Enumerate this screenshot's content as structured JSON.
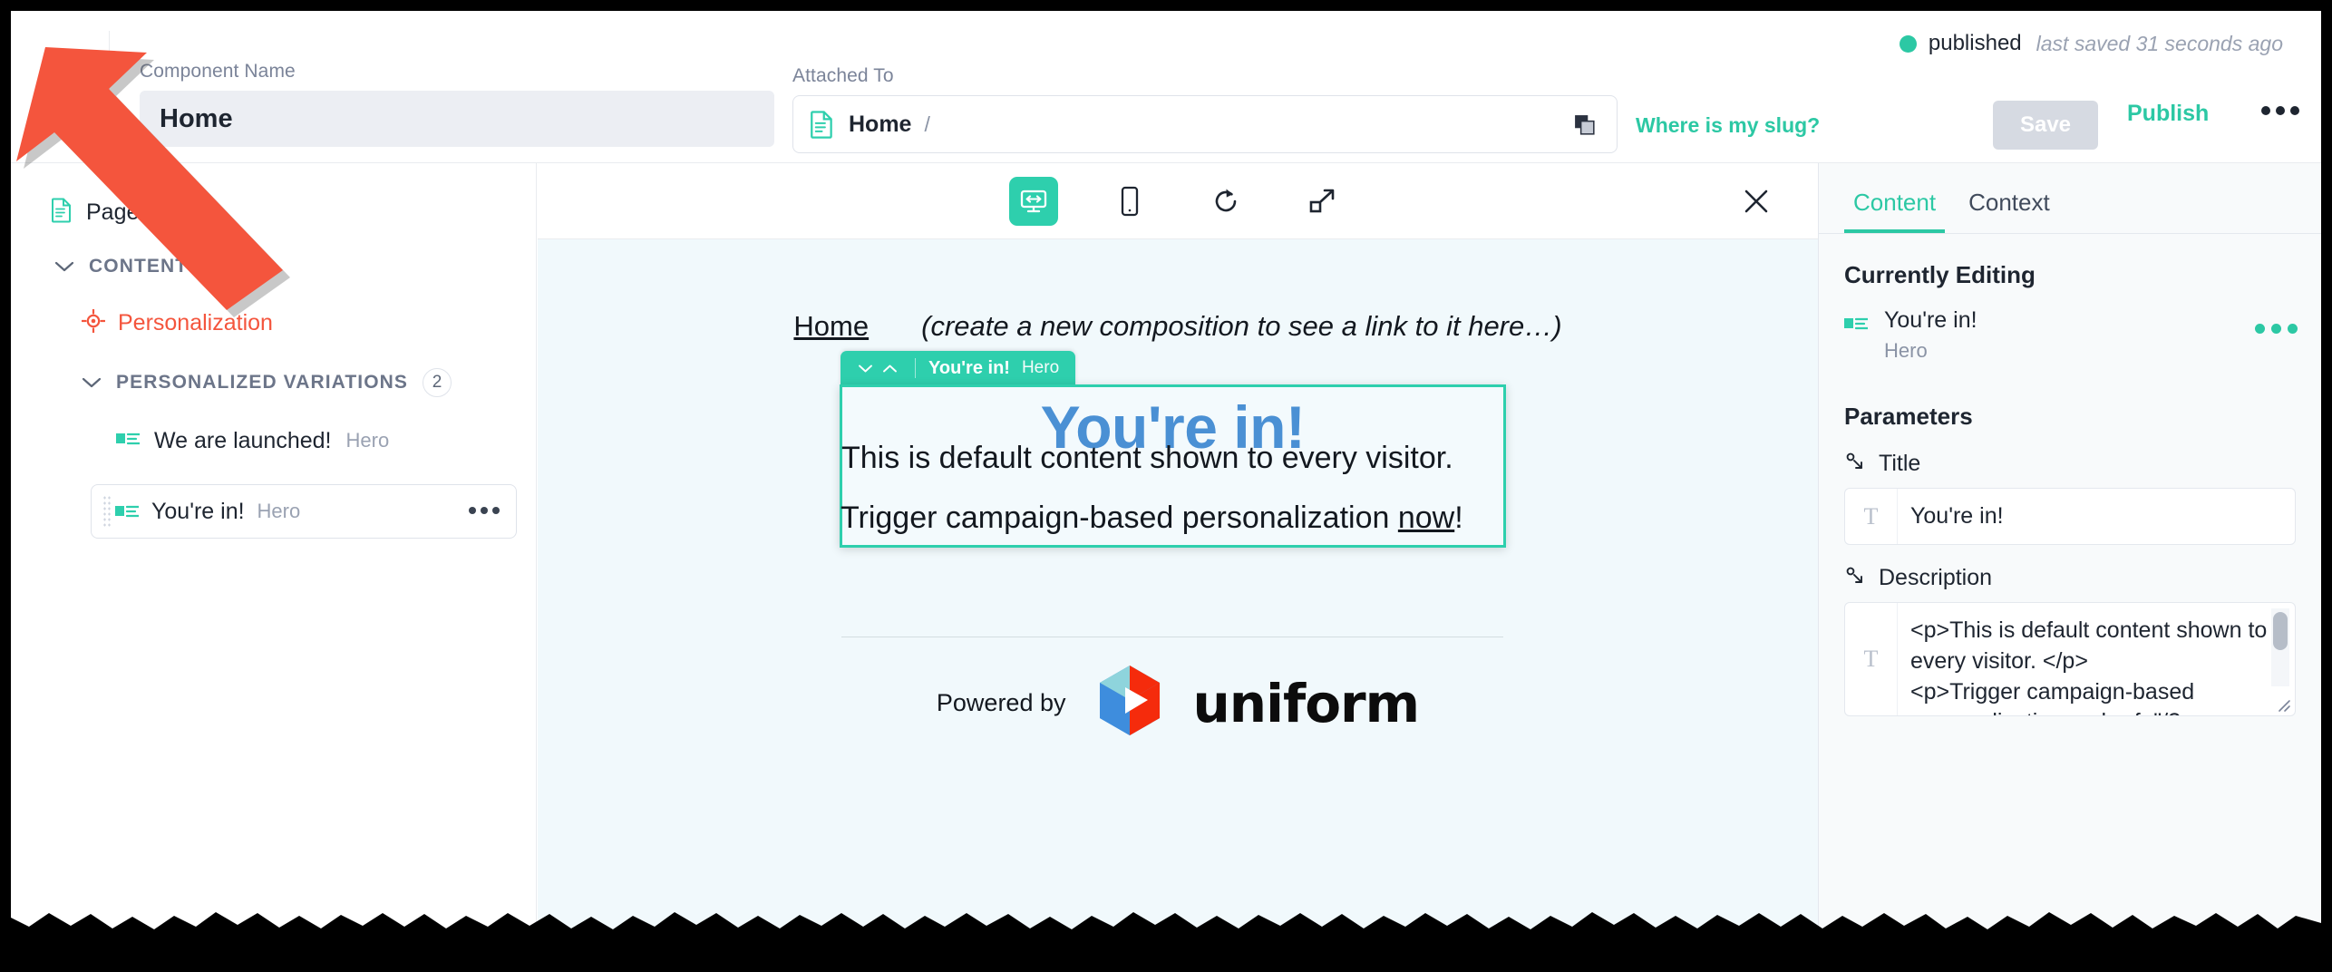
{
  "header": {
    "back_icon": "chevron-left-icon",
    "component_name_label": "Component Name",
    "component_name_value": "Home",
    "component_name_placeholder": "Component Name",
    "attached_to_label": "Attached To",
    "attached_to_value": "Home",
    "attached_to_slug": "/",
    "attached_doc_icon": "document-icon",
    "copy_icon": "copy-icon",
    "where_is_my_slug": "Where is my slug?",
    "status_text": "published",
    "status_color": "#2cc8a4",
    "last_saved": "last saved 31 seconds ago",
    "save_label": "Save",
    "publish_label": "Publish",
    "more_icon": "ellipsis-icon"
  },
  "sidebar": {
    "page_label": "Page",
    "page_icon": "document-icon",
    "content_section": {
      "label": "CONTENT",
      "count": "1",
      "chevron": "chevron-down-icon"
    },
    "personalization": {
      "label": "Personalization",
      "icon": "target-icon",
      "color": "#f4553d"
    },
    "variations_section": {
      "label": "PERSONALIZED VARIATIONS",
      "count": "2",
      "chevron": "chevron-down-icon"
    },
    "variations": [
      {
        "name": "We are launched!",
        "type": "Hero",
        "icon": "component-icon"
      },
      {
        "name": "You're in!",
        "type": "Hero",
        "icon": "component-icon",
        "selected": true,
        "more_icon": "ellipsis-icon"
      }
    ]
  },
  "preview": {
    "toolbar": [
      {
        "name": "desktop-icon",
        "label": "Desktop",
        "active": true
      },
      {
        "name": "mobile-icon",
        "label": "Mobile",
        "active": false
      },
      {
        "name": "refresh-icon",
        "label": "Refresh",
        "active": false
      },
      {
        "name": "expand-icon",
        "label": "Open in new window",
        "active": false
      }
    ],
    "close_icon": "close-icon",
    "nav_home_link": "Home",
    "nav_note": "(create a new composition to see a link to it here…)",
    "hero_tab": {
      "down_icon": "chevron-down-icon",
      "up_icon": "chevron-up-icon",
      "name": "You're in!",
      "type": "Hero"
    },
    "hero": {
      "title": "You're in!",
      "body_1": "This is default content shown to every visitor.",
      "body_2_prefix": "Trigger campaign-based personalization ",
      "body_2_cta": "now",
      "body_2_suffix": "!",
      "title_color": "#4a90d4"
    },
    "footer": {
      "powered_by": "Powered by",
      "brand": "uniform",
      "logo_icon": "uniform-logo-icon"
    }
  },
  "right_panel": {
    "tabs": [
      {
        "label": "Content",
        "active": true
      },
      {
        "label": "Context",
        "active": false
      }
    ],
    "currently_editing_heading": "Currently Editing",
    "currently_editing": {
      "name": "You're in!",
      "type": "Hero",
      "icon": "component-icon",
      "more_icon": "ellipsis-icon"
    },
    "parameters_heading": "Parameters",
    "parameters": [
      {
        "label": "Title",
        "label_icon": "parameter-icon",
        "type_icon": "text-type-icon",
        "value": "You're in!"
      },
      {
        "label": "Description",
        "label_icon": "parameter-icon",
        "type_icon": "text-type-icon",
        "value": "<p>This is default content shown to every visitor. </p>\n<p>Trigger campaign-based personalization <a href=\"/?"
      }
    ]
  },
  "annotation": {
    "arrow_color": "#f4553d",
    "arrow_label": "pointer-arrow"
  }
}
